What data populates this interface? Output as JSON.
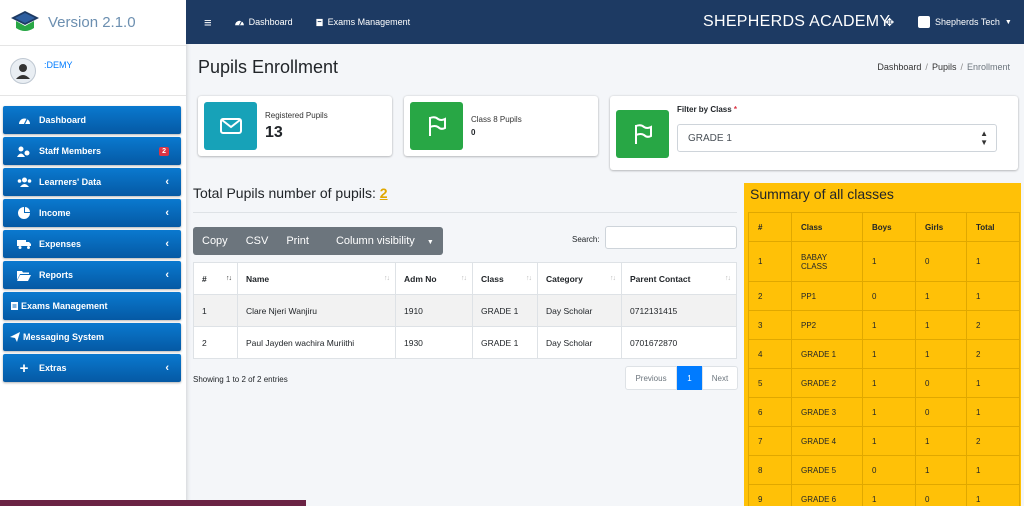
{
  "brand": {
    "version": "Version 2.1.0"
  },
  "user": {
    "name": ":DEMY"
  },
  "sidebar": {
    "items": [
      {
        "label": "Dashboard",
        "icon": "tachometer-icon"
      },
      {
        "label": "Staff Members",
        "icon": "users-cog-icon",
        "badge": "2"
      },
      {
        "label": "Learners' Data",
        "icon": "users-icon"
      },
      {
        "label": "Income",
        "icon": "pie-chart-icon"
      },
      {
        "label": "Expenses",
        "icon": "truck-icon"
      },
      {
        "label": "Reports",
        "icon": "folder-open-icon"
      },
      {
        "label": "Exams Management",
        "icon": "graduation-icon"
      },
      {
        "label": "Messaging System",
        "icon": "paper-plane-icon"
      },
      {
        "label": "Extras",
        "icon": "plus-icon"
      }
    ]
  },
  "topbar": {
    "dashboard": "Dashboard",
    "exams": "Exams Management",
    "school": "SHEPHERDS ACADEMY",
    "account": "Shepherds Tech"
  },
  "page": {
    "title": "Pupils Enrollment",
    "breadcrumb": [
      "Dashboard",
      "Pupils",
      "Enrollment"
    ]
  },
  "stats": {
    "registered_label": "Registered Pupils",
    "registered_value": "13",
    "class8_label": "Class 8 Pupils",
    "class8_value": "0"
  },
  "filter": {
    "label": "Filter by Class",
    "required": "*",
    "value": "GRADE 1"
  },
  "total": {
    "label": "Total Pupils number of pupils:",
    "value": "2"
  },
  "buttons": {
    "copy": "Copy",
    "csv": "CSV",
    "print": "Print",
    "colvis": "Column visibility"
  },
  "search": {
    "label": "Search:"
  },
  "pupils": {
    "headers": [
      "#",
      "Name",
      "Adm No",
      "Class",
      "Category",
      "Parent Contact"
    ],
    "rows": [
      [
        "1",
        "Clare Njeri Wanjiru",
        "1910",
        "GRADE 1",
        "Day Scholar",
        "0712131415"
      ],
      [
        "2",
        "Paul Jayden wachira Muriithi",
        "1930",
        "GRADE 1",
        "Day Scholar",
        "0701672870"
      ]
    ],
    "showing": "Showing 1 to 2 of 2 entries"
  },
  "pager": {
    "prev": "Previous",
    "current": "1",
    "next": "Next"
  },
  "summary": {
    "title": "Summary of all classes",
    "headers": [
      "#",
      "Class",
      "Boys",
      "Girls",
      "Total"
    ],
    "rows": [
      [
        "1",
        "BABAY CLASS",
        "1",
        "0",
        "1"
      ],
      [
        "2",
        "PP1",
        "0",
        "1",
        "1"
      ],
      [
        "3",
        "PP2",
        "1",
        "1",
        "2"
      ],
      [
        "4",
        "GRADE 1",
        "1",
        "1",
        "2"
      ],
      [
        "5",
        "GRADE 2",
        "1",
        "0",
        "1"
      ],
      [
        "6",
        "GRADE 3",
        "1",
        "0",
        "1"
      ],
      [
        "7",
        "GRADE 4",
        "1",
        "1",
        "2"
      ],
      [
        "8",
        "GRADE 5",
        "0",
        "1",
        "1"
      ],
      [
        "9",
        "GRADE 6",
        "1",
        "0",
        "1"
      ]
    ]
  },
  "colors": {
    "navy": "#1d3a63",
    "sidebar_blue": "#0a79cf",
    "teal": "#17a2b8",
    "green": "#28a745",
    "warning": "#ffc107",
    "primary": "#007bff"
  }
}
